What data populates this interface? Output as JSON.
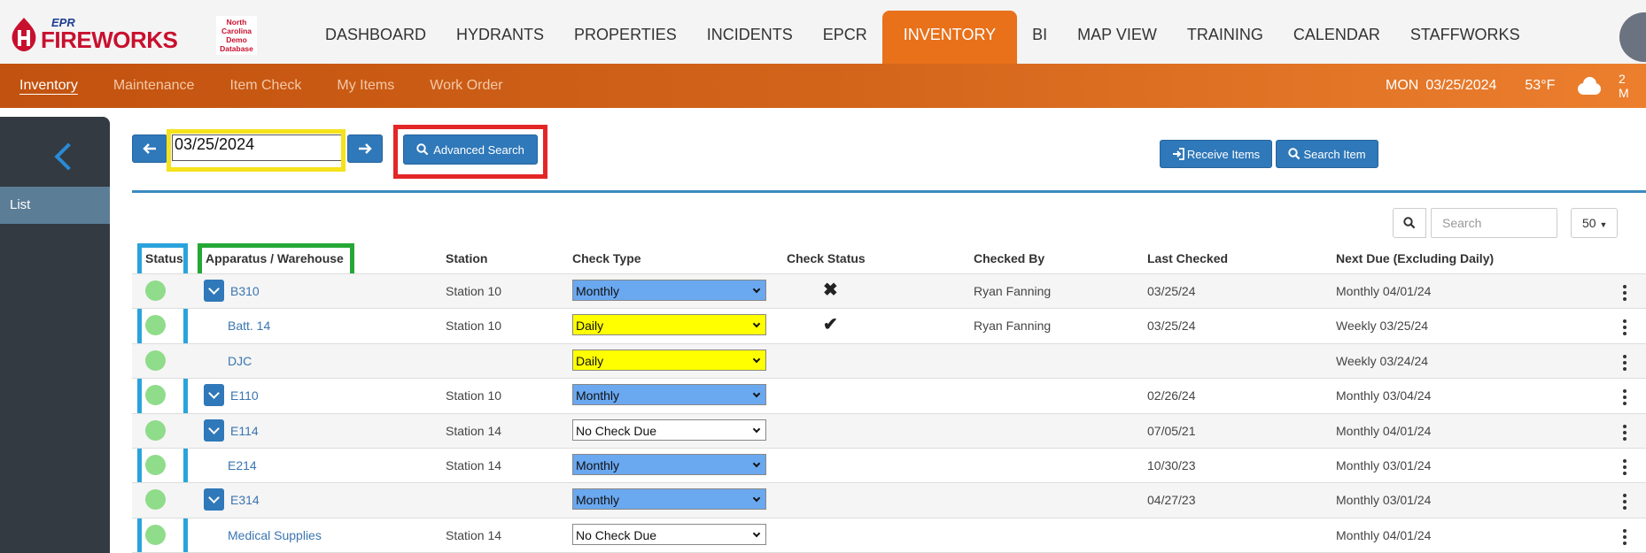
{
  "brand": {
    "epr": "EPR",
    "fireworks": "FIREWORKS",
    "badge": "North Carolina Demo Database"
  },
  "main_nav": [
    {
      "label": "DASHBOARD",
      "active": false
    },
    {
      "label": "HYDRANTS",
      "active": false
    },
    {
      "label": "PROPERTIES",
      "active": false
    },
    {
      "label": "INCIDENTS",
      "active": false
    },
    {
      "label": "EPCR",
      "active": false
    },
    {
      "label": "INVENTORY",
      "active": true
    },
    {
      "label": "BI",
      "active": false
    },
    {
      "label": "MAP VIEW",
      "active": false
    },
    {
      "label": "TRAINING",
      "active": false
    },
    {
      "label": "CALENDAR",
      "active": false
    },
    {
      "label": "STAFFWORKS",
      "active": false
    }
  ],
  "sub_nav": [
    {
      "label": "Inventory",
      "active": true
    },
    {
      "label": "Maintenance",
      "active": false
    },
    {
      "label": "Item Check",
      "active": false
    },
    {
      "label": "My Items",
      "active": false
    },
    {
      "label": "Work Order",
      "active": false
    }
  ],
  "header_info": {
    "day": "MON",
    "date": "03/25/2024",
    "temp": "53°F",
    "weather_icon": "cloud-icon",
    "extra": "2 M"
  },
  "sidebar": {
    "list_label": "List"
  },
  "toolbar": {
    "date_value": "03/25/2024",
    "advanced_search_label": "Advanced Search",
    "receive_items_label": "Receive Items",
    "search_item_label": "Search Item",
    "search_placeholder": "Search",
    "page_size": "50"
  },
  "colors": {
    "primary": "#2f78b9",
    "accent": "#e8711a",
    "status_ok": "#8fdc8a",
    "monthly": "#6aa8f0",
    "daily": "#ffff00",
    "highlight_yellow": "#f5e21b",
    "highlight_red": "#e32626",
    "highlight_green": "#25a836",
    "highlight_blue": "#2aa3dc"
  },
  "table": {
    "headers": {
      "status": "Status",
      "apparatus": "Apparatus / Warehouse",
      "station": "Station",
      "check_type": "Check Type",
      "check_status": "Check Status",
      "checked_by": "Checked By",
      "last_checked": "Last Checked",
      "next_due": "Next Due (Excluding Daily)"
    },
    "rows": [
      {
        "name": "B310",
        "expandable": true,
        "station": "Station 10",
        "check_type": "Monthly",
        "check_color": "#6aa8f0",
        "check_status": "✖",
        "checked_by": "Ryan Fanning",
        "last_checked": "03/25/24",
        "next_due": "Monthly 04/01/24"
      },
      {
        "name": "Batt. 14",
        "expandable": false,
        "station": "Station 10",
        "check_type": "Daily",
        "check_color": "#ffff00",
        "check_status": "✔",
        "checked_by": "Ryan Fanning",
        "last_checked": "03/25/24",
        "next_due": "Weekly 03/25/24"
      },
      {
        "name": "DJC",
        "expandable": false,
        "station": "",
        "check_type": "Daily",
        "check_color": "#ffff00",
        "check_status": "",
        "checked_by": "",
        "last_checked": "",
        "next_due": "Weekly 03/24/24"
      },
      {
        "name": "E110",
        "expandable": true,
        "station": "Station 10",
        "check_type": "Monthly",
        "check_color": "#6aa8f0",
        "check_status": "",
        "checked_by": "",
        "last_checked": "02/26/24",
        "next_due": "Monthly 03/04/24"
      },
      {
        "name": "E114",
        "expandable": true,
        "station": "Station 14",
        "check_type": "No Check Due",
        "check_color": "#ffffff",
        "check_status": "",
        "checked_by": "",
        "last_checked": "07/05/21",
        "next_due": "Monthly 04/01/24"
      },
      {
        "name": "E214",
        "expandable": false,
        "station": "Station 14",
        "check_type": "Monthly",
        "check_color": "#6aa8f0",
        "check_status": "",
        "checked_by": "",
        "last_checked": "10/30/23",
        "next_due": "Monthly 03/01/24"
      },
      {
        "name": "E314",
        "expandable": true,
        "station": "",
        "check_type": "Monthly",
        "check_color": "#6aa8f0",
        "check_status": "",
        "checked_by": "",
        "last_checked": "04/27/23",
        "next_due": "Monthly 03/01/24"
      },
      {
        "name": "Medical Supplies",
        "expandable": false,
        "station": "Station 14",
        "check_type": "No Check Due",
        "check_color": "#ffffff",
        "check_status": "",
        "checked_by": "",
        "last_checked": "",
        "next_due": "Monthly 04/01/24"
      }
    ]
  }
}
